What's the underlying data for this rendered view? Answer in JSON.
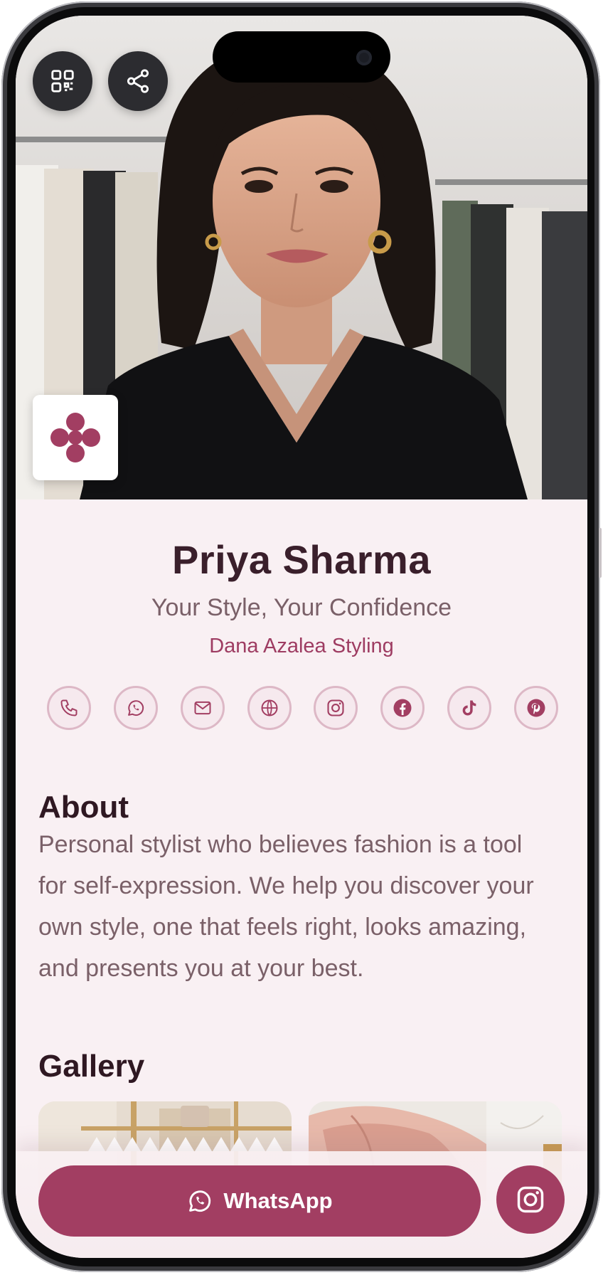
{
  "profile": {
    "name": "Priya Sharma",
    "tagline": "Your Style, Your Confidence",
    "company": "Dana Azalea Styling"
  },
  "header_actions": [
    {
      "icon": "qr-code-icon"
    },
    {
      "icon": "share-icon"
    }
  ],
  "socials": [
    {
      "icon": "phone-icon"
    },
    {
      "icon": "whatsapp-icon"
    },
    {
      "icon": "email-icon"
    },
    {
      "icon": "website-icon"
    },
    {
      "icon": "instagram-icon"
    },
    {
      "icon": "facebook-icon"
    },
    {
      "icon": "tiktok-icon"
    },
    {
      "icon": "pinterest-icon"
    }
  ],
  "about": {
    "title": "About",
    "text": "Personal stylist who believes fashion is a tool for self-expression. We help you discover your own style, one that feels right, looks amazing, and presents you at your best."
  },
  "gallery": {
    "title": "Gallery"
  },
  "cta": {
    "whatsapp_label": "WhatsApp"
  },
  "colors": {
    "accent": "#a23e62",
    "background": "#f9f0f3",
    "heading": "#3a1f2b",
    "body_text": "#7a6068"
  }
}
